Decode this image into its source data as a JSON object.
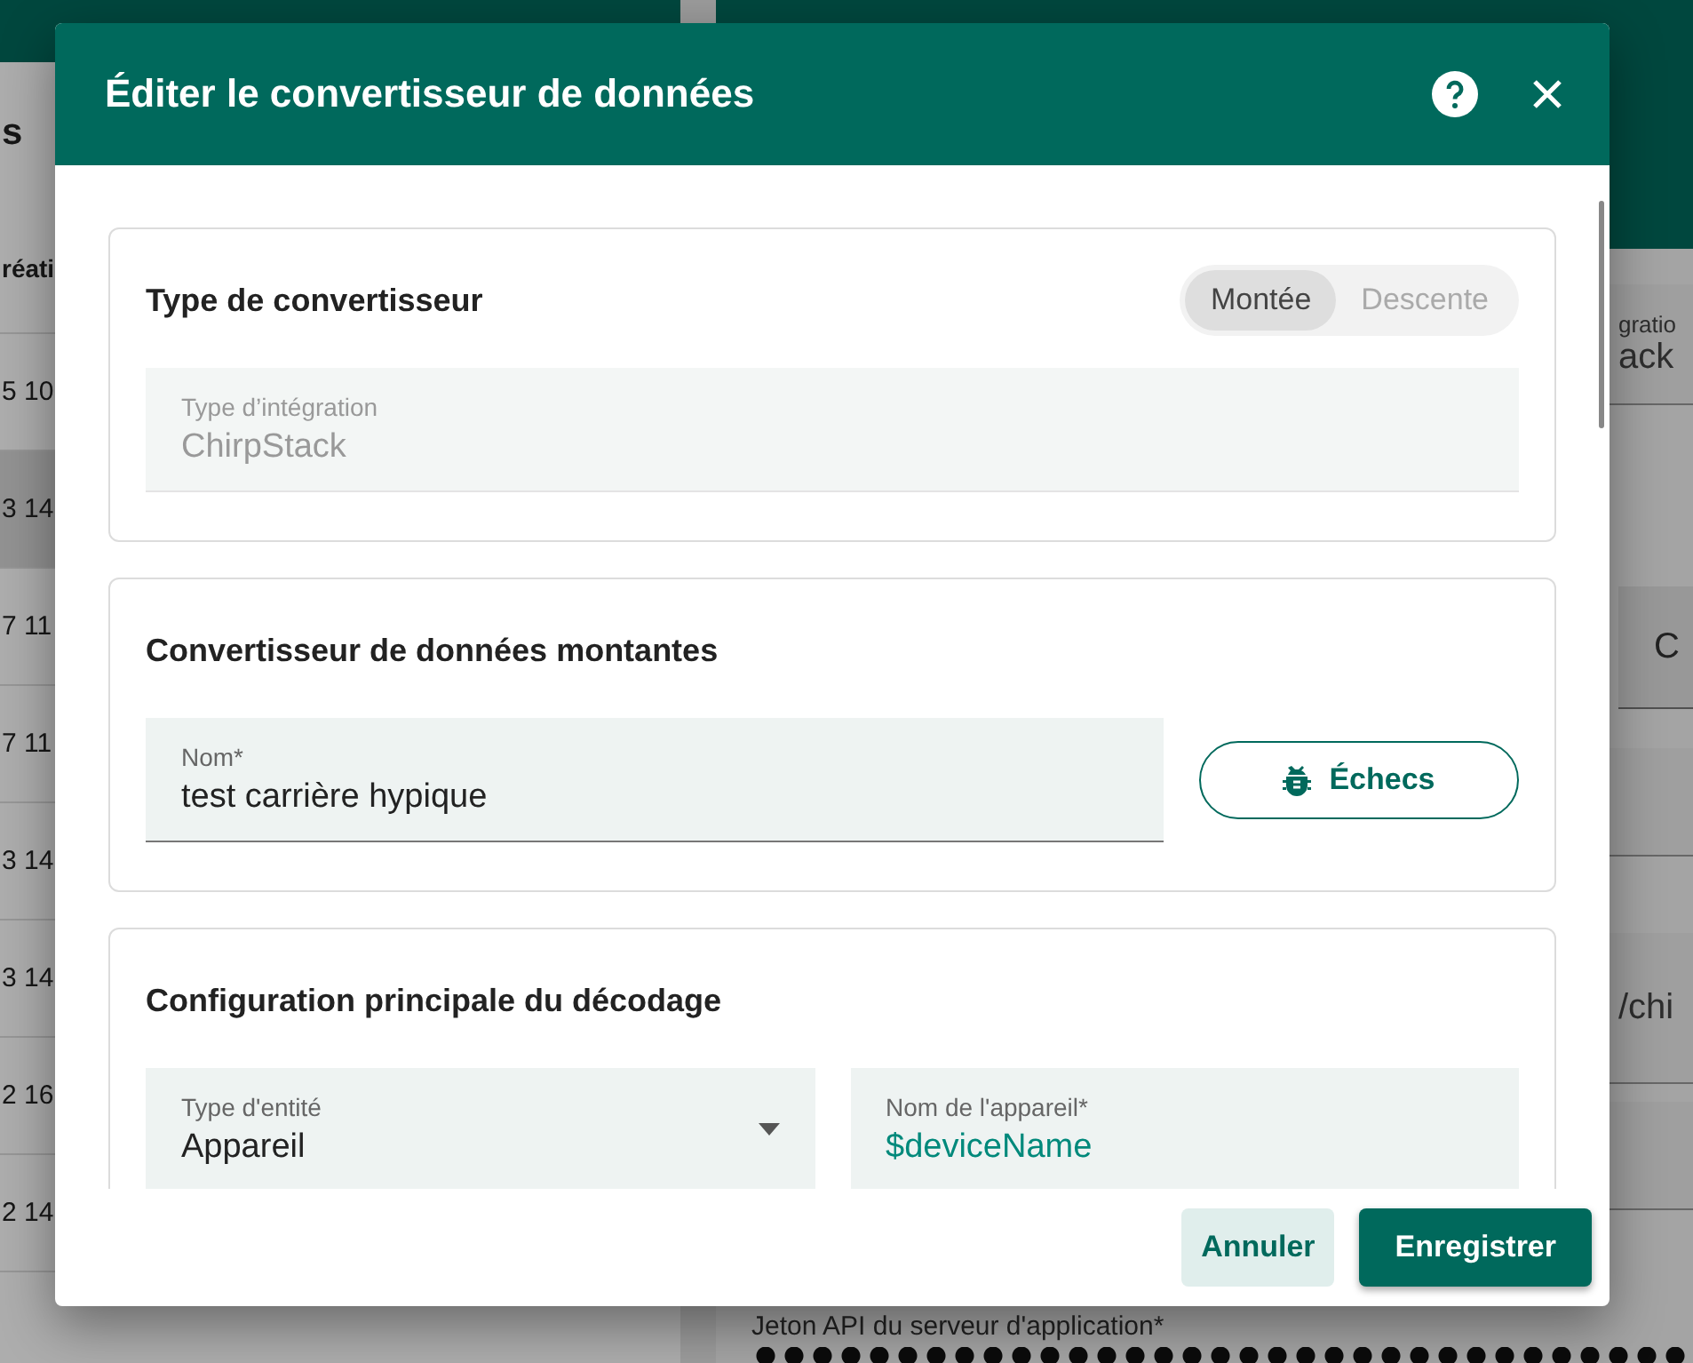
{
  "background": {
    "page_title": "s",
    "column_heading": "réati",
    "rows": [
      {
        "time": "5 10",
        "selected": false
      },
      {
        "time": "3 14",
        "selected": true
      },
      {
        "time": "7 11",
        "selected": false
      },
      {
        "time": "7 11",
        "selected": false
      },
      {
        "time": "3 14",
        "selected": false
      },
      {
        "time": "3 14",
        "selected": false
      },
      {
        "time": "2 16",
        "selected": false
      },
      {
        "time": "2 14",
        "selected": false
      }
    ],
    "detail": {
      "integration_label": "gratio",
      "integration_value": "ack",
      "button": "C",
      "path_value": "/chi",
      "token_label": "Jeton API du serveur d'application*"
    }
  },
  "dialog": {
    "title": "Éditer le convertisseur de données",
    "sections": [
      {
        "kind": "type",
        "title": "Type de convertisseur",
        "toggle": [
          {
            "label": "Montée",
            "selected": true
          },
          {
            "label": "Descente",
            "selected": false
          }
        ],
        "fields": [
          {
            "kind": "text",
            "label": "Type d’intégration",
            "value": "ChirpStack",
            "disabled": true
          }
        ]
      },
      {
        "kind": "name",
        "title": "Convertisseur de données montantes",
        "fields": [
          {
            "kind": "text",
            "label": "Nom*",
            "value": "test carrière hypique",
            "disabled": false
          }
        ],
        "button": "Échecs"
      },
      {
        "kind": "decoding",
        "title": "Configuration principale du décodage",
        "fields": [
          {
            "kind": "select",
            "label": "Type d'entité",
            "value": "Appareil",
            "disabled": false
          },
          {
            "kind": "pattern",
            "label": "Nom de l'appareil*",
            "value": "$deviceName",
            "disabled": false
          }
        ]
      }
    ],
    "buttons": [
      {
        "label": "Annuler",
        "kind": "secondary"
      },
      {
        "label": "Enregistrer",
        "kind": "primary"
      }
    ]
  }
}
